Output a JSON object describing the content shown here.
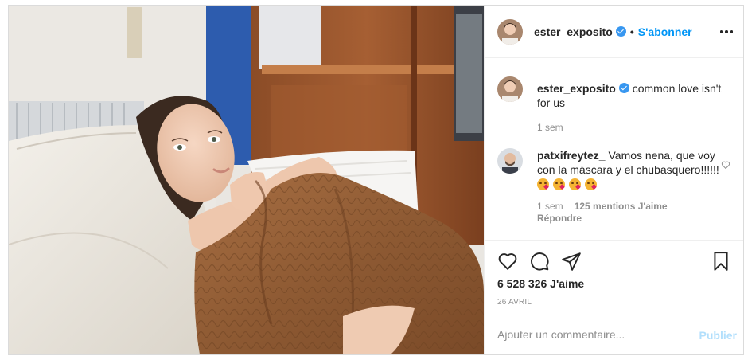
{
  "header": {
    "username": "ester_exposito",
    "separator": "•",
    "follow_label": "S'abonner",
    "more_icon": "more-horizontal-icon",
    "verified_icon": "verified-badge-icon"
  },
  "caption": {
    "username": "ester_exposito",
    "text": "common love isn't for us",
    "age": "1 sem"
  },
  "comments": [
    {
      "username": "patxifreytez_",
      "text": "Vamos nena, que voy con la máscara y el chubasquero!!!!!!",
      "emoji": [
        "face-blowing-kiss",
        "face-blowing-kiss",
        "face-blowing-kiss",
        "face-blowing-kiss"
      ],
      "age": "1 sem",
      "likes": "125 mentions J'aime",
      "reply_label": "Répondre"
    }
  ],
  "actions": {
    "like_icon": "heart-outline-icon",
    "comment_icon": "comment-bubble-icon",
    "share_icon": "paper-plane-icon",
    "save_icon": "bookmark-icon"
  },
  "likes_count": "6 528 326 J'aime",
  "post_date": "26 AVRIL",
  "add_comment": {
    "placeholder": "Ajouter un commentaire...",
    "value": "",
    "publish_label": "Publier"
  },
  "colors": {
    "accent": "#0095f6",
    "verified": "#3897f0",
    "publish_disabled": "#b2dffc",
    "muted": "#8e8e8e"
  }
}
